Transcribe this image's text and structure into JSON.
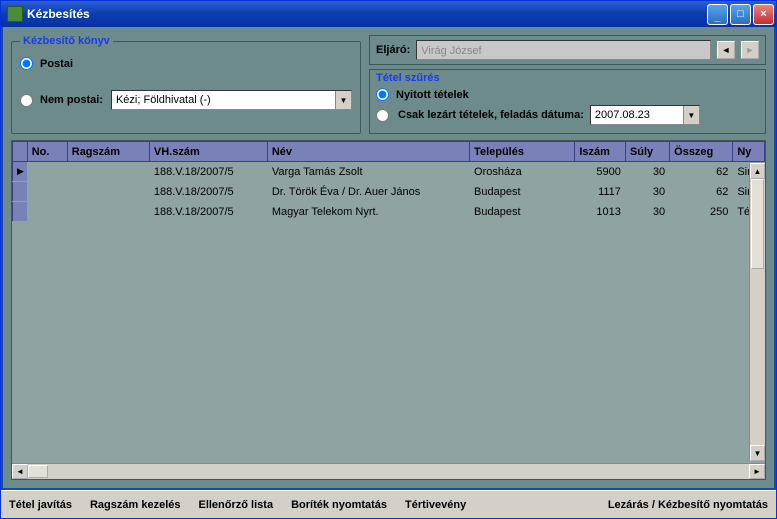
{
  "window": {
    "title": "Kézbesítés"
  },
  "groupbox_left": {
    "legend": "Kézbesítő könyv",
    "radio_postai": "Postai",
    "radio_nem_postai": "Nem postai:",
    "nem_postai_value": "Kézi; Földhivatal (-)"
  },
  "eljaro": {
    "label": "Eljáró:",
    "value": "Virág József"
  },
  "filter": {
    "legend": "Tétel szűrés",
    "radio_open": "Nyitott tételek",
    "radio_closed": "Csak lezárt tételek, feladás dátuma:",
    "date": "2007.08.23"
  },
  "grid": {
    "columns": [
      "",
      "No.",
      "Ragszám",
      "VH.szám",
      "Név",
      "Település",
      "Iszám",
      "Súly",
      "Összeg",
      "Ny"
    ],
    "rows": [
      {
        "indicator": "▶",
        "no": "",
        "ragszam": "",
        "vhszam": "188.V.18/2007/5",
        "nev": "Varga Tamás Zsolt",
        "telepules": "Orosháza",
        "iszam": "5900",
        "suly": "30",
        "osszeg": "62",
        "ny": "Sin"
      },
      {
        "indicator": "",
        "no": "",
        "ragszam": "",
        "vhszam": "188.V.18/2007/5",
        "nev": "Dr. Török Éva / Dr. Auer János",
        "telepules": "Budapest",
        "iszam": "1117",
        "suly": "30",
        "osszeg": "62",
        "ny": "Sin"
      },
      {
        "indicator": "",
        "no": "",
        "ragszam": "",
        "vhszam": "188.V.18/2007/5",
        "nev": "Magyar Telekom Nyrt.",
        "telepules": "Budapest",
        "iszam": "1013",
        "suly": "30",
        "osszeg": "250",
        "ny": "Tér"
      }
    ]
  },
  "bottombar": {
    "tetel_javitas": "Tétel javítás",
    "ragszam_kezeles": "Ragszám kezelés",
    "ellenorzo_lista": "Ellenőrző lista",
    "boritek_nyomtatas": "Boríték nyomtatás",
    "tertivegveny": "Tértivevény",
    "lezaras": "Lezárás / Kézbesítő nyomtatás"
  }
}
